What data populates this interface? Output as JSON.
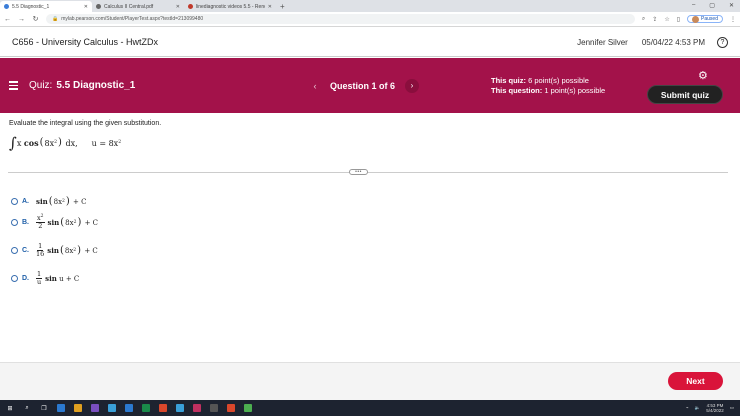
{
  "browser": {
    "tabs": [
      {
        "label": "5.5 Diagnostic_1",
        "active": true
      },
      {
        "label": "Calculus II Central.pdf",
        "active": false
      },
      {
        "label": "linediagnostic videos 5.5 - Rencon...",
        "active": false
      }
    ],
    "new_tab": "+",
    "url": "mylab.pearson.com/Student/PlayerTest.aspx?testId=213099480",
    "profile_status": "Paused",
    "window_controls": [
      "–",
      "▢",
      "✕"
    ]
  },
  "header": {
    "course_title": "C656 - University Calculus - HwtZDx",
    "user_name": "Jennifer Silver",
    "datetime": "05/04/22 4:53 PM",
    "help_icon": "?"
  },
  "banner": {
    "quiz_label": "Quiz:",
    "quiz_name": "5.5 Diagnostic_1",
    "question_counter": "Question 1 of 6",
    "prev_arrow": "‹",
    "next_arrow": "›",
    "this_quiz_label": "This quiz:",
    "this_quiz_value": "6 point(s) possible",
    "this_question_label": "This question:",
    "this_question_value": "1 point(s) possible",
    "submit_label": "Submit quiz",
    "colors": {
      "banner": "#a3124a",
      "submit": "#222222"
    }
  },
  "question": {
    "instruction": "Evaluate the integral using the given substitution.",
    "integrand_x": "x",
    "integrand_fn": "cos",
    "inner": "8x",
    "dx": "dx,",
    "substitution": "u = 8x"
  },
  "options": [
    {
      "letter": "A.",
      "fn": "sin",
      "inner": "8x",
      "tail": "+ C"
    },
    {
      "letter": "B.",
      "frac_num": "x",
      "frac_den": "2",
      "fn": "sin",
      "inner": "8x",
      "tail": "+ C"
    },
    {
      "letter": "C.",
      "frac_num": "1",
      "frac_den": "16",
      "fn": "sin",
      "inner": "8x",
      "tail": "+ C"
    },
    {
      "letter": "D.",
      "frac_num": "1",
      "frac_den": "u",
      "fn": "sin",
      "arg": "u",
      "tail": "+ C"
    }
  ],
  "exponent": "2",
  "footer": {
    "next_label": "Next",
    "next_color": "#d9143a"
  },
  "taskbar": {
    "time": "4:53 PM",
    "date": "5/4/2022"
  }
}
